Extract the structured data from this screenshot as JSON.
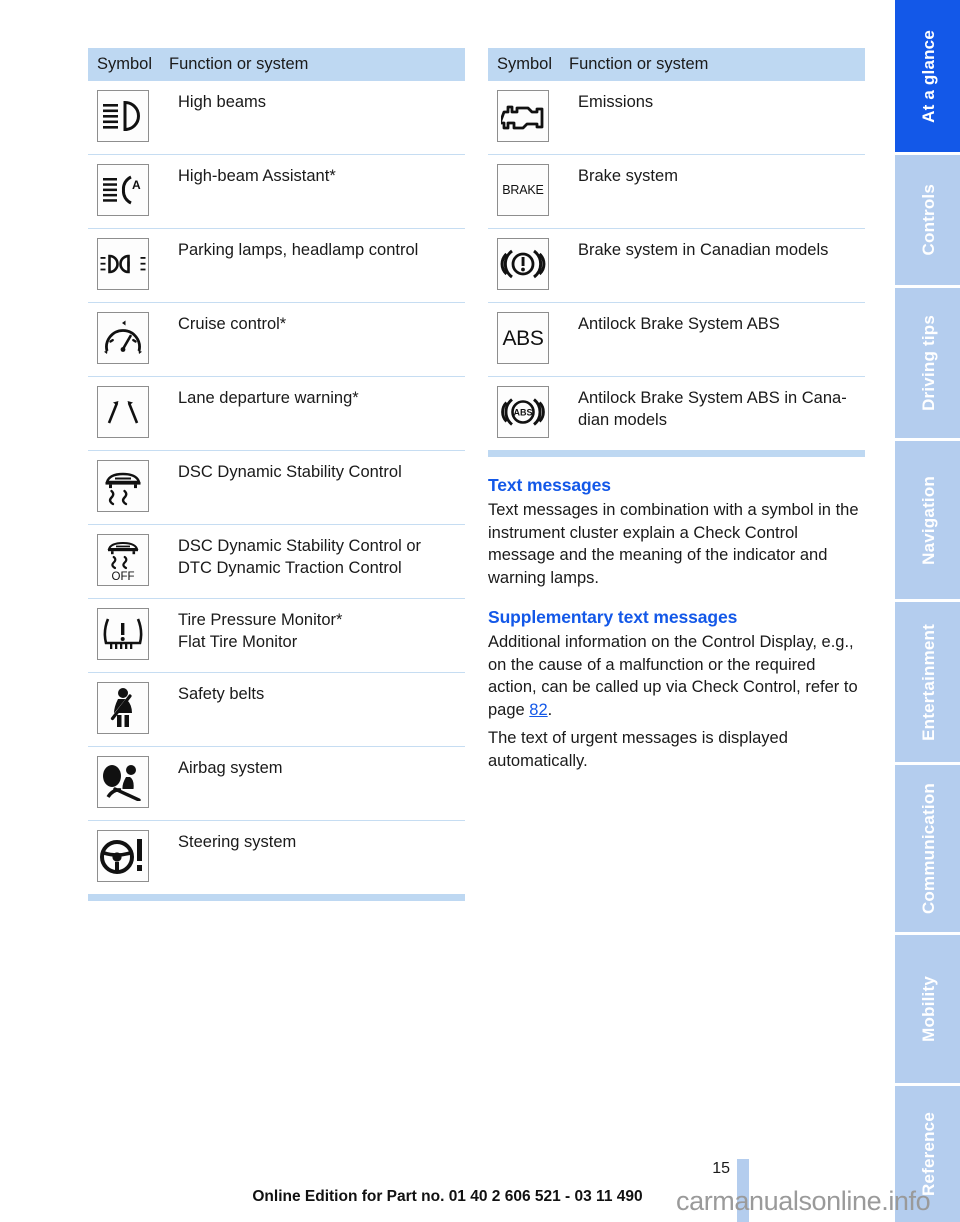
{
  "document": {
    "page_number": "15",
    "footer_text": "Online Edition for Part no. 01 40 2 606 521 - 03 11 490",
    "watermark": "carmanualsonline.info"
  },
  "colors": {
    "accent_blue": "#1358e8",
    "tab_inactive": "#b4cdee",
    "table_header_bg": "#bed8f2",
    "rule": "#c6ddf2"
  },
  "nav_rail": {
    "tabs": [
      {
        "label": "At a glance",
        "active": true
      },
      {
        "label": "Controls",
        "active": false
      },
      {
        "label": "Driving tips",
        "active": false
      },
      {
        "label": "Navigation",
        "active": false
      },
      {
        "label": "Entertainment",
        "active": false
      },
      {
        "label": "Communication",
        "active": false
      },
      {
        "label": "Mobility",
        "active": false
      },
      {
        "label": "Reference",
        "active": false
      }
    ]
  },
  "left_table": {
    "headers": {
      "symbol": "Symbol",
      "function": "Function or system"
    },
    "rows": [
      {
        "icon": "high-beams-icon",
        "line1": "High beams",
        "line2": ""
      },
      {
        "icon": "high-beam-assistant-icon",
        "line1": "High-beam Assistant*",
        "line2": ""
      },
      {
        "icon": "parking-lamps-headlamp-control-icon",
        "line1": "Parking lamps, headlamp control",
        "line2": ""
      },
      {
        "icon": "cruise-control-icon",
        "line1": "Cruise control*",
        "line2": ""
      },
      {
        "icon": "lane-departure-warning-icon",
        "line1": "Lane departure warning*",
        "line2": ""
      },
      {
        "icon": "dsc-icon",
        "line1": "DSC Dynamic Stability Control",
        "line2": ""
      },
      {
        "icon": "dsc-dtc-off-icon",
        "line1": "DSC Dynamic Stability Control or",
        "line2": "DTC Dynamic Traction Control"
      },
      {
        "icon": "tire-pressure-monitor-icon",
        "line1": "Tire Pressure Monitor*",
        "line2": "Flat Tire Monitor"
      },
      {
        "icon": "safety-belts-icon",
        "line1": "Safety belts",
        "line2": ""
      },
      {
        "icon": "airbag-system-icon",
        "line1": "Airbag system",
        "line2": ""
      },
      {
        "icon": "steering-system-icon",
        "line1": "Steering system",
        "line2": ""
      }
    ]
  },
  "right_table": {
    "headers": {
      "symbol": "Symbol",
      "function": "Function or system"
    },
    "rows": [
      {
        "icon": "emissions-engine-icon",
        "line1": "Emissions",
        "line2": ""
      },
      {
        "icon": "brake-system-icon",
        "icon_text": "BRAKE",
        "line1": "Brake system",
        "line2": ""
      },
      {
        "icon": "brake-system-canadian-icon",
        "line1": "Brake system in Canadian models",
        "line2": ""
      },
      {
        "icon": "abs-icon",
        "icon_text": "ABS",
        "line1": "Antilock Brake System ABS",
        "line2": ""
      },
      {
        "icon": "abs-canadian-icon",
        "icon_text": "ABS",
        "line1": "Antilock Brake System ABS in Cana-",
        "line2": "dian models"
      }
    ]
  },
  "sections": [
    {
      "title": "Text messages",
      "paragraphs": [
        "Text messages in combination with a symbol in the instrument cluster explain a Check Control message and the meaning of the indicator and warning lamps."
      ]
    },
    {
      "title": "Supplementary text messages",
      "paragraphs": [
        "Additional information on the Control Display, e.g., on the cause of a malfunction or the required action, can be called up via Check Control, refer to page ",
        "The text of urgent messages is displayed automatically."
      ],
      "page_ref": "82",
      "page_ref_suffix": "."
    }
  ]
}
